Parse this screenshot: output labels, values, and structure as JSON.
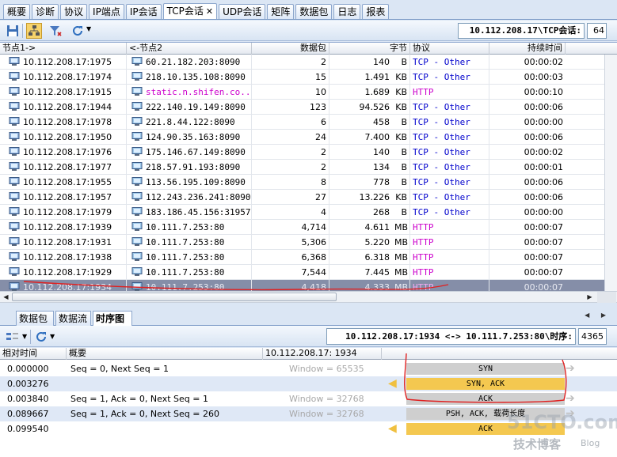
{
  "tabs": [
    {
      "label": "概要",
      "active": false
    },
    {
      "label": "诊断",
      "active": false
    },
    {
      "label": "协议",
      "active": false
    },
    {
      "label": "IP端点",
      "active": false
    },
    {
      "label": "IP会话",
      "active": false
    },
    {
      "label": "TCP会话",
      "active": true
    },
    {
      "label": "UDP会话",
      "active": false
    },
    {
      "label": "矩阵",
      "active": false
    },
    {
      "label": "数据包",
      "active": false
    },
    {
      "label": "日志",
      "active": false
    },
    {
      "label": "报表",
      "active": false
    }
  ],
  "tab_close_glyph": "✕",
  "toolbar": {
    "icons": [
      "save-icon",
      "hierarchy-icon",
      "filter-icon",
      "refresh-icon"
    ],
    "session_path": "10.112.208.17\\TCP会话:",
    "session_count": "64"
  },
  "grid": {
    "columns": [
      "节点1->",
      "<-节点2",
      "数据包",
      "字节",
      "协议",
      "持续时间"
    ],
    "rows": [
      {
        "node1": "10.112.208.17:1975",
        "node2": "60.21.182.203:8090",
        "packets": "2",
        "bytes": "140",
        "unit": "B",
        "proto": "TCP - Other",
        "type": "tcp",
        "duration": "00:00:02"
      },
      {
        "node1": "10.112.208.17:1974",
        "node2": "218.10.135.108:8090",
        "packets": "15",
        "bytes": "1.491",
        "unit": "KB",
        "proto": "TCP - Other",
        "type": "tcp",
        "duration": "00:00:03"
      },
      {
        "node1": "10.112.208.17:1915",
        "node2": "static.n.shifen.co...",
        "packets": "10",
        "bytes": "1.689",
        "unit": "KB",
        "proto": "HTTP",
        "type": "http",
        "duration": "00:00:10",
        "node2_link": true
      },
      {
        "node1": "10.112.208.17:1944",
        "node2": "222.140.19.149:8090",
        "packets": "123",
        "bytes": "94.526",
        "unit": "KB",
        "proto": "TCP - Other",
        "type": "tcp",
        "duration": "00:00:06"
      },
      {
        "node1": "10.112.208.17:1978",
        "node2": "221.8.44.122:8090",
        "packets": "6",
        "bytes": "458",
        "unit": "B",
        "proto": "TCP - Other",
        "type": "tcp",
        "duration": "00:00:00"
      },
      {
        "node1": "10.112.208.17:1950",
        "node2": "124.90.35.163:8090",
        "packets": "24",
        "bytes": "7.400",
        "unit": "KB",
        "proto": "TCP - Other",
        "type": "tcp",
        "duration": "00:00:06"
      },
      {
        "node1": "10.112.208.17:1976",
        "node2": "175.146.67.149:8090",
        "packets": "2",
        "bytes": "140",
        "unit": "B",
        "proto": "TCP - Other",
        "type": "tcp",
        "duration": "00:00:02"
      },
      {
        "node1": "10.112.208.17:1977",
        "node2": "218.57.91.193:8090",
        "packets": "2",
        "bytes": "134",
        "unit": "B",
        "proto": "TCP - Other",
        "type": "tcp",
        "duration": "00:00:01"
      },
      {
        "node1": "10.112.208.17:1955",
        "node2": "113.56.195.109:8090",
        "packets": "8",
        "bytes": "778",
        "unit": "B",
        "proto": "TCP - Other",
        "type": "tcp",
        "duration": "00:00:06"
      },
      {
        "node1": "10.112.208.17:1957",
        "node2": "112.243.236.241:8090",
        "packets": "27",
        "bytes": "13.226",
        "unit": "KB",
        "proto": "TCP - Other",
        "type": "tcp",
        "duration": "00:00:06"
      },
      {
        "node1": "10.112.208.17:1979",
        "node2": "183.186.45.156:31957",
        "packets": "4",
        "bytes": "268",
        "unit": "B",
        "proto": "TCP - Other",
        "type": "tcp",
        "duration": "00:00:00"
      },
      {
        "node1": "10.112.208.17:1939",
        "node2": "10.111.7.253:80",
        "packets": "4,714",
        "bytes": "4.611",
        "unit": "MB",
        "proto": "HTTP",
        "type": "http",
        "duration": "00:00:07"
      },
      {
        "node1": "10.112.208.17:1931",
        "node2": "10.111.7.253:80",
        "packets": "5,306",
        "bytes": "5.220",
        "unit": "MB",
        "proto": "HTTP",
        "type": "http",
        "duration": "00:00:07"
      },
      {
        "node1": "10.112.208.17:1938",
        "node2": "10.111.7.253:80",
        "packets": "6,368",
        "bytes": "6.318",
        "unit": "MB",
        "proto": "HTTP",
        "type": "http",
        "duration": "00:00:07"
      },
      {
        "node1": "10.112.208.17:1929",
        "node2": "10.111.7.253:80",
        "packets": "7,544",
        "bytes": "7.445",
        "unit": "MB",
        "proto": "HTTP",
        "type": "http",
        "duration": "00:00:07"
      },
      {
        "node1": "10.112.208.17:1934",
        "node2": "10.111.7.253:80",
        "packets": "4,418",
        "bytes": "4.333",
        "unit": "MB",
        "proto": "HTTP",
        "type": "http",
        "duration": "00:00:07",
        "selected": true
      }
    ]
  },
  "bottom_tabs": [
    {
      "label": "数据包",
      "active": false
    },
    {
      "label": "数据流",
      "active": false
    },
    {
      "label": "时序图",
      "active": true
    }
  ],
  "flow": {
    "path": "10.112.208.17:1934 <-> 10.111.7.253:80\\时序:",
    "count": "4365"
  },
  "sequence": {
    "columns": [
      "相对时间",
      "概要",
      "10.112.208.17: 1934"
    ],
    "rows": [
      {
        "time": "0.000000",
        "summary": "Seq = 0, Next Seq = 1",
        "window": "Window = 65535",
        "dir": "right",
        "label": "SYN"
      },
      {
        "time": "0.003276",
        "summary": "",
        "window": "",
        "dir": "left",
        "label": "SYN, ACK"
      },
      {
        "time": "0.003840",
        "summary": "Seq = 1, Ack = 0, Next Seq = 1",
        "window": "Window = 32768",
        "dir": "right",
        "label": "ACK"
      },
      {
        "time": "0.089667",
        "summary": "Seq = 1, Ack = 0, Next Seq = 260",
        "window": "Window = 32768",
        "dir": "right",
        "label": "PSH, ACK, 载荷长度"
      },
      {
        "time": "0.099540",
        "summary": "",
        "window": "",
        "dir": "left",
        "label": "ACK"
      }
    ]
  },
  "watermark": {
    "main": "51CTO.com",
    "sub": "技术博客",
    "blog": "Blog"
  },
  "colors": {
    "accent": "#dbe6f4",
    "selected_row": "#858ea8",
    "tcp_text": "#0000cc",
    "http_text": "#cc00cc",
    "ack_arrow": "#f4c850",
    "syn_arrow": "#cfcfcf",
    "annotation": "#e02020"
  }
}
